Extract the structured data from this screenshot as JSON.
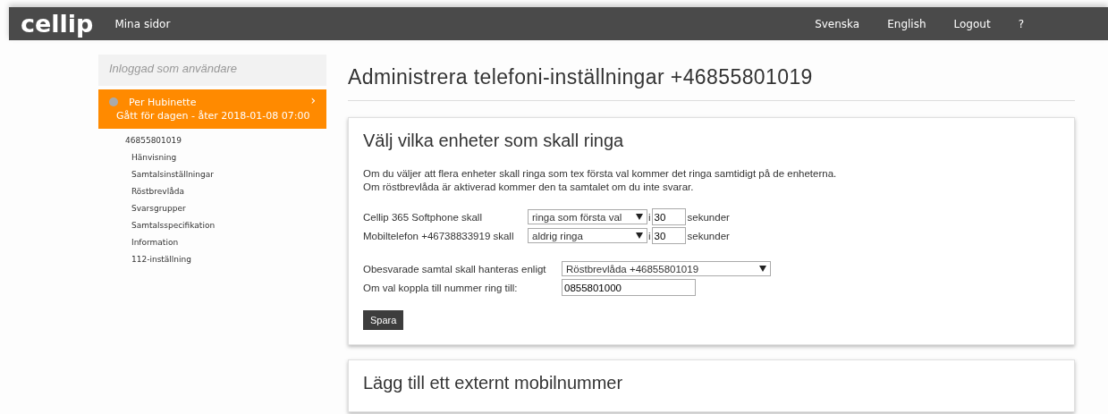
{
  "topbar": {
    "logo": "cellip",
    "title": "Mina sidor",
    "links": [
      "Svenska",
      "English",
      "Logout",
      "?"
    ]
  },
  "sidebar": {
    "header": "Inloggad som användare",
    "user": {
      "name": "Per Hubinette",
      "status": "Gått för dagen - åter 2018-01-08 07:00",
      "selected": true,
      "chevron": "›"
    },
    "number": "46855801019",
    "items": [
      {
        "label": "Hänvisning"
      },
      {
        "label": "Samtalsinställningar"
      },
      {
        "label": "Röstbrevlåda"
      },
      {
        "label": "Svarsgrupper"
      },
      {
        "label": "Samtalsspecifikation"
      },
      {
        "label": "Information"
      },
      {
        "label": "112-inställning"
      }
    ]
  },
  "page_title": "Administrera telefoni-inställningar +46855801019",
  "card": {
    "title": "Välj vilka enheter som skall ringa",
    "description": [
      "Om du väljer att flera enheter skall ringa som tex första val kommer det ringa samtidigt på de enheterna.",
      "Om röstbrevlåda är aktiverad kommer den ta samtalet om du inte svarar."
    ],
    "devices": [
      {
        "label": "Cellip 365 Softphone skall",
        "choice": "ringa som första val",
        "in": "i",
        "seconds": "30",
        "unit": "sekunder"
      },
      {
        "label": "Mobiltelefon +46738833919 skall",
        "choice": "aldrig ringa",
        "in": "i",
        "seconds": "30",
        "unit": "sekunder"
      }
    ],
    "unanswered_label": "Obesvarade samtal skall hanteras enligt",
    "unanswered_choice": "Röstbrevlåda +46855801019",
    "forward_label": "Om val koppla till nummer ring till:",
    "forward_value": "0855801000",
    "save": "Spara"
  },
  "card2": {
    "title": "Lägg till ett externt mobilnummer"
  }
}
